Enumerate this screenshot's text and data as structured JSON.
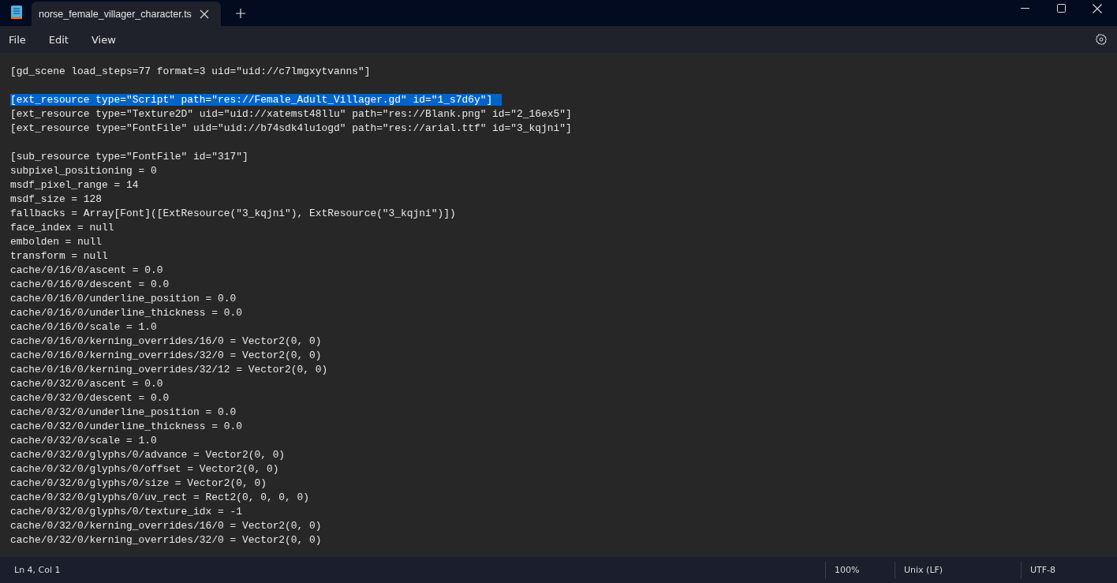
{
  "window": {
    "tab_title": "norse_female_villager_character.ts"
  },
  "menu": [
    "File",
    "Edit",
    "View"
  ],
  "editor": {
    "blocks": [
      [
        {
          "text": "[gd_scene load_steps=77 format=3 uid=\"uid://c7lmgxytvanns\"]",
          "selected": false
        }
      ],
      [
        {
          "text": "[ext_resource type=\"Script\" path=\"res://Female_Adult_Villager.gd\" id=\"1_s7d6y\"]",
          "selected": true
        },
        {
          "text": "[ext_resource type=\"Texture2D\" uid=\"uid://xatemst48llu\" path=\"res://Blank.png\" id=\"2_16ex5\"]",
          "selected": false
        },
        {
          "text": "[ext_resource type=\"FontFile\" uid=\"uid://b74sdk4lu1ogd\" path=\"res://arial.ttf\" id=\"3_kqjni\"]",
          "selected": false
        }
      ],
      [
        {
          "text": "[sub_resource type=\"FontFile\" id=\"317\"]",
          "selected": false
        },
        {
          "text": "subpixel_positioning = 0",
          "selected": false
        },
        {
          "text": "msdf_pixel_range = 14",
          "selected": false
        },
        {
          "text": "msdf_size = 128",
          "selected": false
        },
        {
          "text": "fallbacks = Array[Font]([ExtResource(\"3_kqjni\"), ExtResource(\"3_kqjni\")])",
          "selected": false
        },
        {
          "text": "face_index = null",
          "selected": false
        },
        {
          "text": "embolden = null",
          "selected": false
        },
        {
          "text": "transform = null",
          "selected": false
        },
        {
          "text": "cache/0/16/0/ascent = 0.0",
          "selected": false
        },
        {
          "text": "cache/0/16/0/descent = 0.0",
          "selected": false
        },
        {
          "text": "cache/0/16/0/underline_position = 0.0",
          "selected": false
        },
        {
          "text": "cache/0/16/0/underline_thickness = 0.0",
          "selected": false
        },
        {
          "text": "cache/0/16/0/scale = 1.0",
          "selected": false
        },
        {
          "text": "cache/0/16/0/kerning_overrides/16/0 = Vector2(0, 0)",
          "selected": false
        },
        {
          "text": "cache/0/16/0/kerning_overrides/32/0 = Vector2(0, 0)",
          "selected": false
        },
        {
          "text": "cache/0/16/0/kerning_overrides/32/12 = Vector2(0, 0)",
          "selected": false
        },
        {
          "text": "cache/0/32/0/ascent = 0.0",
          "selected": false
        },
        {
          "text": "cache/0/32/0/descent = 0.0",
          "selected": false
        },
        {
          "text": "cache/0/32/0/underline_position = 0.0",
          "selected": false
        },
        {
          "text": "cache/0/32/0/underline_thickness = 0.0",
          "selected": false
        },
        {
          "text": "cache/0/32/0/scale = 1.0",
          "selected": false
        },
        {
          "text": "cache/0/32/0/glyphs/0/advance = Vector2(0, 0)",
          "selected": false
        },
        {
          "text": "cache/0/32/0/glyphs/0/offset = Vector2(0, 0)",
          "selected": false
        },
        {
          "text": "cache/0/32/0/glyphs/0/size = Vector2(0, 0)",
          "selected": false
        },
        {
          "text": "cache/0/32/0/glyphs/0/uv_rect = Rect2(0, 0, 0, 0)",
          "selected": false
        },
        {
          "text": "cache/0/32/0/glyphs/0/texture_idx = -1",
          "selected": false
        },
        {
          "text": "cache/0/32/0/kerning_overrides/16/0 = Vector2(0, 0)",
          "selected": false
        },
        {
          "text": "cache/0/32/0/kerning_overrides/32/0 = Vector2(0, 0)",
          "selected": false
        }
      ]
    ]
  },
  "status_bar": {
    "position": "Ln 4, Col 1",
    "zoom": "100%",
    "line_ending": "Unix (LF)",
    "encoding": "UTF-8"
  }
}
